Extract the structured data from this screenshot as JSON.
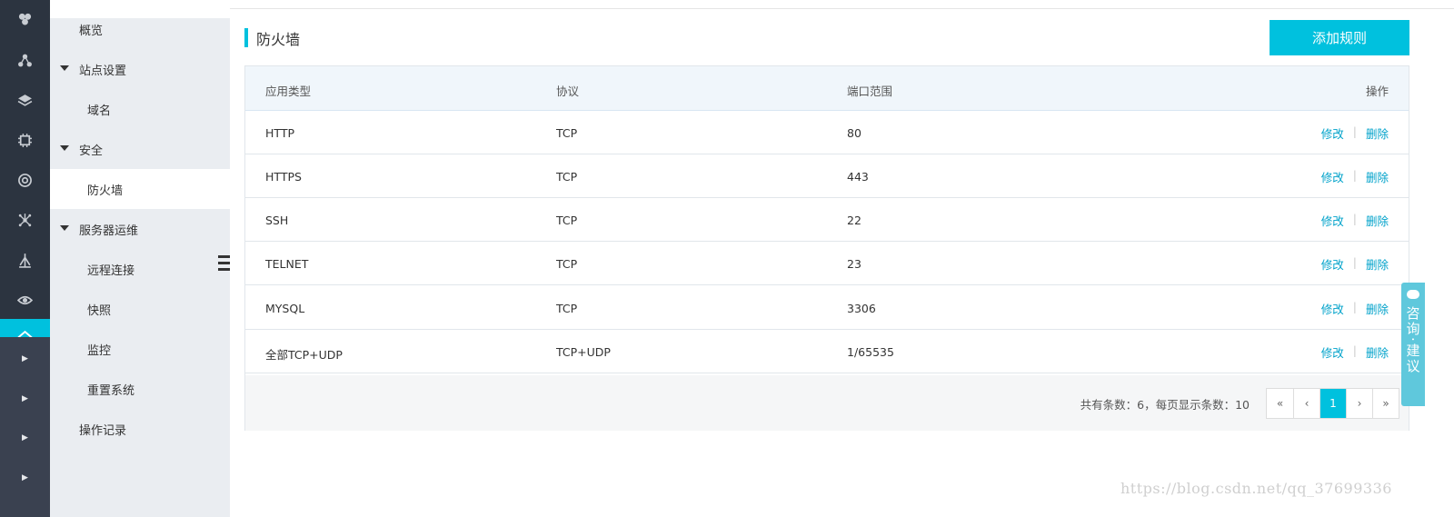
{
  "sidebar": {
    "items": [
      {
        "label": "概览"
      },
      {
        "label": "站点设置"
      },
      {
        "label": "域名"
      },
      {
        "label": "安全"
      },
      {
        "label": "防火墙"
      },
      {
        "label": "服务器运维"
      },
      {
        "label": "远程连接"
      },
      {
        "label": "快照"
      },
      {
        "label": "监控"
      },
      {
        "label": "重置系统"
      },
      {
        "label": "操作记录"
      }
    ]
  },
  "rail": {
    "icons": [
      "cluster-icon",
      "network-icon",
      "layers-icon",
      "chip-icon",
      "eye-ring-icon",
      "molecule-icon",
      "branch-icon",
      "eye-icon"
    ],
    "accent": "#00c1de"
  },
  "header": {
    "title": "防火墙",
    "add_button": "添加规则"
  },
  "table": {
    "columns": [
      "应用类型",
      "协议",
      "端口范围",
      "操作"
    ],
    "rows": [
      {
        "type": "HTTP",
        "protocol": "TCP",
        "port": "80"
      },
      {
        "type": "HTTPS",
        "protocol": "TCP",
        "port": "443"
      },
      {
        "type": "SSH",
        "protocol": "TCP",
        "port": "22"
      },
      {
        "type": "TELNET",
        "protocol": "TCP",
        "port": "23"
      },
      {
        "type": "MYSQL",
        "protocol": "TCP",
        "port": "3306"
      },
      {
        "type": "全部TCP+UDP",
        "protocol": "TCP+UDP",
        "port": "1/65535"
      }
    ],
    "edit_label": "修改",
    "delete_label": "删除",
    "separator": "|"
  },
  "pagination": {
    "info": "共有条数：6，每页显示条数：10",
    "first": "«",
    "prev": "‹",
    "current": "1",
    "next": "›",
    "last": "»"
  },
  "consult": {
    "label": "咨询·建议"
  },
  "watermark": "https://blog.csdn.net/qq_37699336"
}
